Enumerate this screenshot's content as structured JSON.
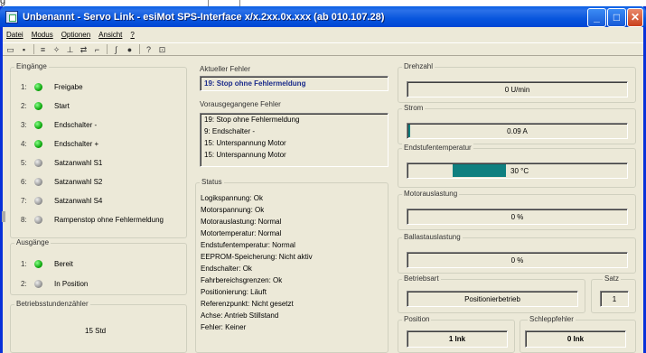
{
  "fragment": {
    "text": "g"
  },
  "window": {
    "title": "Unbenannt - Servo Link - esiMot SPS-Interface x/x.2xx.0x.xxx (ab 010.107.28)"
  },
  "titlebar_buttons": {
    "minimize": "_",
    "maximize": "□",
    "close": "✕"
  },
  "menu": [
    "Datei",
    "Modus",
    "Optionen",
    "Ansicht",
    "?"
  ],
  "toolbar": {
    "icons": [
      "open-icon",
      "save-icon",
      "config-icon",
      "tools-icon",
      "pin-icon",
      "transfer-icon",
      "scope-icon",
      "curve-icon",
      "globe-icon",
      "help-icon",
      "exit-icon"
    ]
  },
  "eingaenge": {
    "title": "Eingänge",
    "items": [
      {
        "n": "1:",
        "label": "Freigabe",
        "state": "on"
      },
      {
        "n": "2:",
        "label": "Start",
        "state": "on"
      },
      {
        "n": "3:",
        "label": "Endschalter -",
        "state": "on"
      },
      {
        "n": "4:",
        "label": "Endschalter +",
        "state": "on"
      },
      {
        "n": "5:",
        "label": "Satzanwahl S1",
        "state": "off"
      },
      {
        "n": "6:",
        "label": "Satzanwahl S2",
        "state": "off"
      },
      {
        "n": "7:",
        "label": "Satzanwahl S4",
        "state": "off"
      },
      {
        "n": "8:",
        "label": "Rampenstop ohne Fehlermeldung",
        "state": "off"
      }
    ]
  },
  "ausgaenge": {
    "title": "Ausgänge",
    "items": [
      {
        "n": "1:",
        "label": "Bereit",
        "state": "on"
      },
      {
        "n": "2:",
        "label": "In Position",
        "state": "off"
      }
    ]
  },
  "betriebsstunden": {
    "title": "Betriebsstundenzähler",
    "value": "15 Std"
  },
  "aktueller_fehler": {
    "title": "Aktueller Fehler",
    "value": "19: Stop ohne Fehlermeldung"
  },
  "vorausgegangene": {
    "title": "Vorausgegangene Fehler",
    "items": [
      "19: Stop ohne Fehlermeldung",
      "9: Endschalter -",
      "15: Unterspannung Motor",
      "15: Unterspannung Motor"
    ]
  },
  "status": {
    "title": "Status",
    "items": [
      "Logikspannung: Ok",
      "Motorspannung: Ok",
      "Motorauslastung: Normal",
      "Motortemperatur: Normal",
      "Endstufentemperatur: Normal",
      "EEPROM-Speicherung: Nicht aktiv",
      "Endschalter: Ok",
      "Fahrbereichsgrenzen: Ok",
      "Positionierung: Läuft",
      "Referenzpunkt: Nicht gesetzt",
      "Achse: Antrieb Stillstand",
      "Fehler: Keiner"
    ]
  },
  "drehzahl": {
    "title": "Drehzahl",
    "value": "0 U/min"
  },
  "strom": {
    "title": "Strom",
    "value": "0.09 A",
    "fill": 0.01
  },
  "endstufentemp": {
    "title": "Endstufentemperatur",
    "value": "30 °C",
    "fill": 0.5
  },
  "motorauslastung": {
    "title": "Motorauslastung",
    "value": "0 %"
  },
  "ballastauslastung": {
    "title": "Ballastauslastung",
    "value": "0 %"
  },
  "betriebsart": {
    "title": "Betriebsart",
    "value": "Positionierbetrieb"
  },
  "satz": {
    "title": "Satz",
    "value": "1"
  },
  "position": {
    "title": "Position",
    "value": "1 Ink"
  },
  "schleppfehler": {
    "title": "Schleppfehler",
    "value": "0 Ink"
  },
  "colors": {
    "title_bar": "#0a5fe6",
    "led_on": "#1a1",
    "led_off": "#999",
    "bar": "#108080",
    "error_text": "#1a2b8a"
  }
}
